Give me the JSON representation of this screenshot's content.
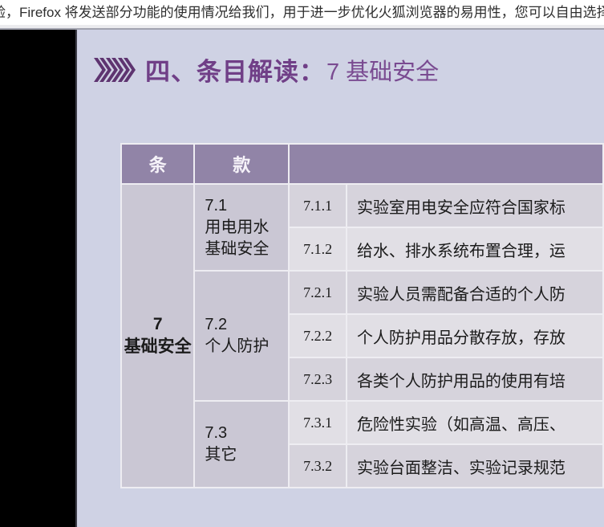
{
  "notification": {
    "text": "验，Firefox 将发送部分功能的使用情况给我们，用于进一步优化火狐浏览器的易用性，您可以自由选择是否向我"
  },
  "slide": {
    "title_prefix": "四、条目解读：",
    "title_topic": "7 基础安全",
    "table": {
      "header": {
        "article": "条",
        "clause": "款",
        "items": ""
      },
      "article": {
        "number": "7",
        "name": "基础安全"
      },
      "clauses": [
        {
          "number": "7.1",
          "name": "用电用水基础安全",
          "items": [
            {
              "number": "7.1.1",
              "text": "实验室用电安全应符合国家标"
            },
            {
              "number": "7.1.2",
              "text": "给水、排水系统布置合理，运"
            }
          ]
        },
        {
          "number": "7.2",
          "name": "个人防护",
          "items": [
            {
              "number": "7.2.1",
              "text": "实验人员需配备合适的个人防"
            },
            {
              "number": "7.2.2",
              "text": "个人防护用品分散存放，存放"
            },
            {
              "number": "7.2.3",
              "text": "各类个人防护用品的使用有培"
            }
          ]
        },
        {
          "number": "7.3",
          "name": "其它",
          "items": [
            {
              "number": "7.3.1",
              "text": "危险性实验（如高温、高压、"
            },
            {
              "number": "7.3.2",
              "text": "实验台面整洁、实验记录规范"
            }
          ]
        }
      ]
    }
  },
  "colors": {
    "slide_background": "#cfd2e4",
    "table_header": "#9184a7",
    "group_column": "#cac7d4",
    "row_band_dark": "#d6d3dc",
    "row_band_light": "#e1dfe5",
    "title_purple": "#703f87",
    "chevron_purple": "#5e3470",
    "sidebar_black": "#000000"
  }
}
